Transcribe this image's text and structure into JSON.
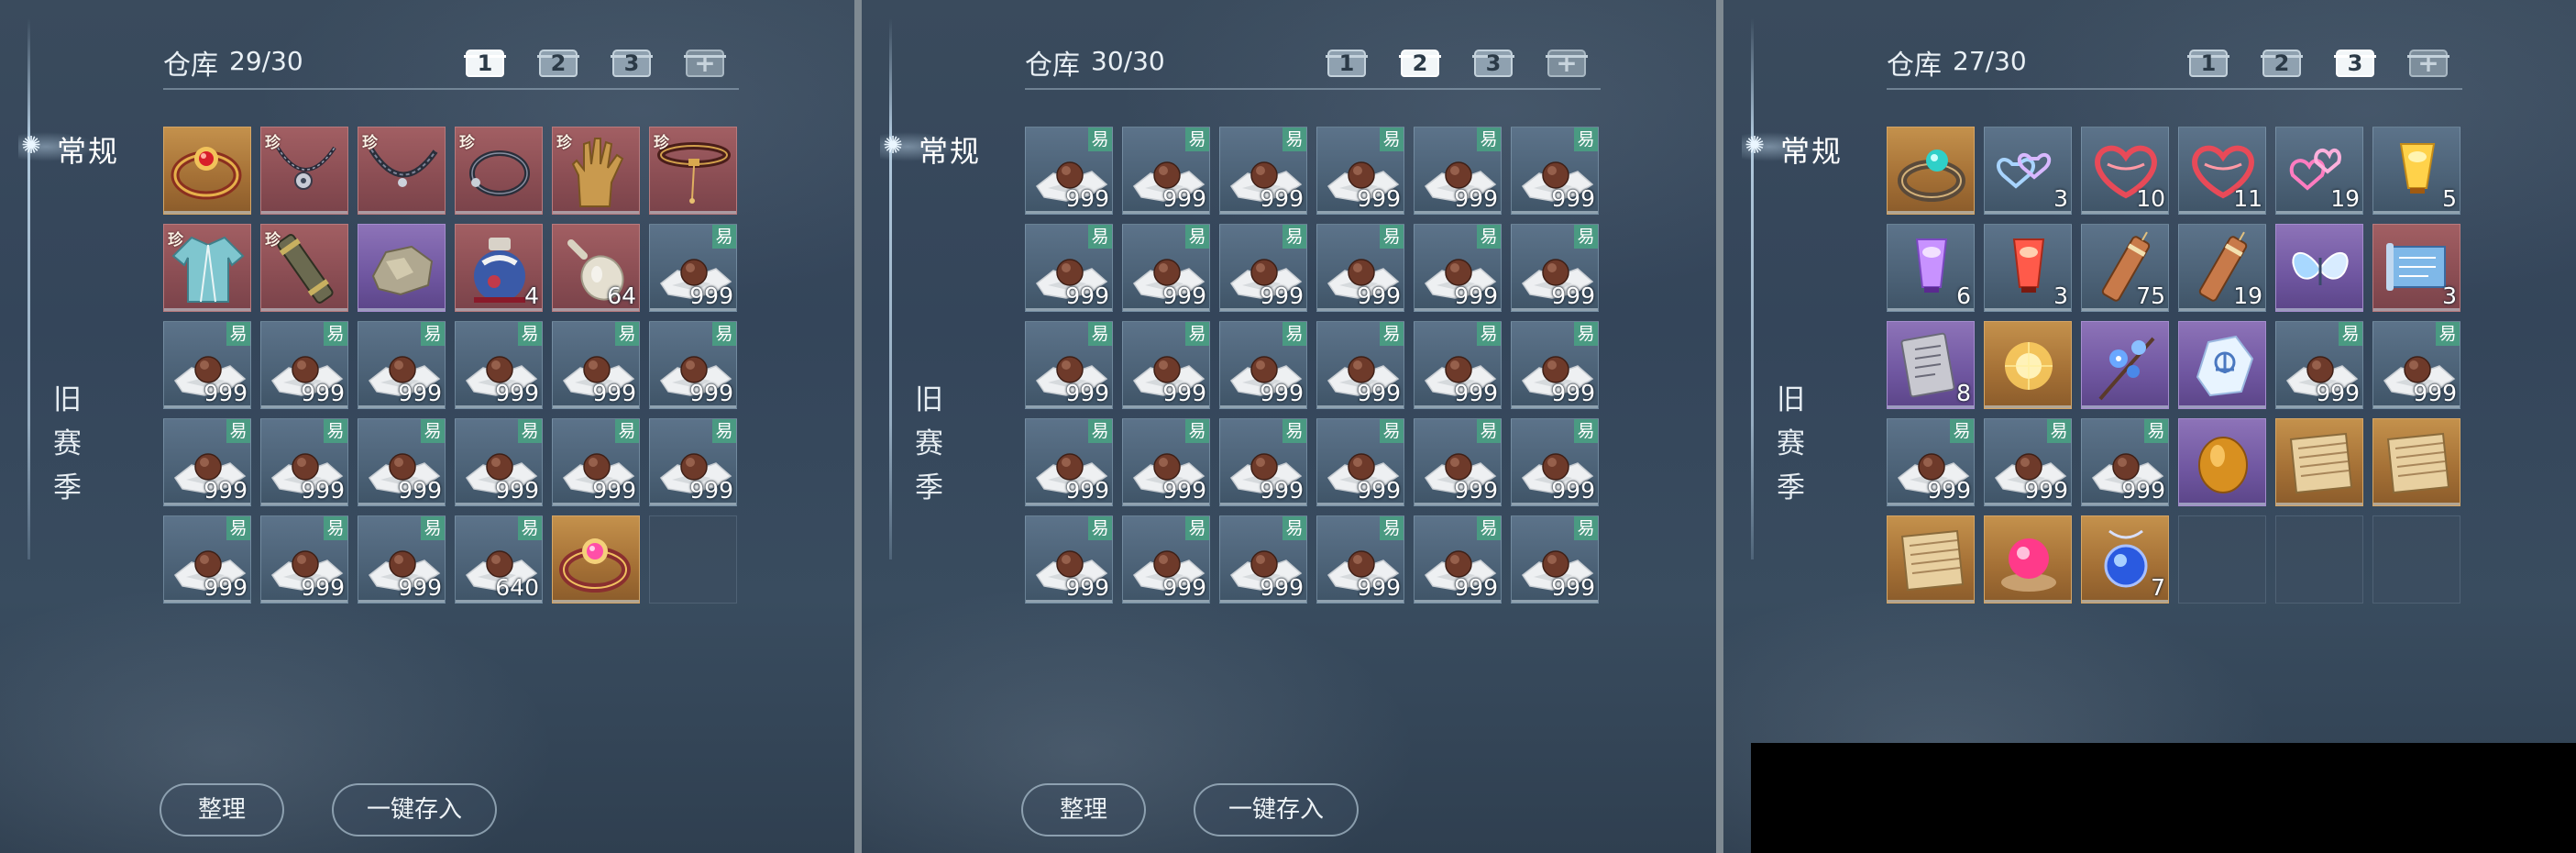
{
  "categories": {
    "regular": "常规",
    "old_season": "旧赛季"
  },
  "warehouse_title": "仓库",
  "tabs": [
    "1",
    "2",
    "3",
    "+"
  ],
  "buttons": {
    "sort": "整理",
    "deposit_all": "一键存入"
  },
  "badges": {
    "tradable": "易",
    "rare": "珍"
  },
  "panels": [
    {
      "count": "29/30",
      "active_tab": 1,
      "slots": [
        {
          "icon": "ruby-bracelet-icon",
          "bg": "gold",
          "qty": ""
        },
        {
          "icon": "pendant-necklace-icon",
          "bg": "red",
          "rare": true,
          "qty": ""
        },
        {
          "icon": "chain-necklace-icon",
          "bg": "red",
          "rare": true,
          "qty": ""
        },
        {
          "icon": "choker-necklace-icon",
          "bg": "red",
          "rare": true,
          "qty": ""
        },
        {
          "icon": "glove-icon",
          "bg": "red",
          "rare": true,
          "qty": ""
        },
        {
          "icon": "belt-icon",
          "bg": "red",
          "rare": true,
          "qty": ""
        },
        {
          "icon": "robe-icon",
          "bg": "red",
          "rare": true,
          "qty": ""
        },
        {
          "icon": "scroll-tube-icon",
          "bg": "red",
          "rare": true,
          "qty": ""
        },
        {
          "icon": "ore-chunk-icon",
          "bg": "purple",
          "qty": ""
        },
        {
          "icon": "jar-icon",
          "bg": "red",
          "qty": "4"
        },
        {
          "icon": "gourd-flask-icon",
          "bg": "red",
          "qty": "64"
        },
        {
          "icon": "chocolate-icon",
          "bg": "blue",
          "trade": true,
          "qty": "999"
        },
        {
          "icon": "chocolate-icon",
          "bg": "blue",
          "trade": true,
          "qty": "999"
        },
        {
          "icon": "chocolate-icon",
          "bg": "blue",
          "trade": true,
          "qty": "999"
        },
        {
          "icon": "chocolate-icon",
          "bg": "blue",
          "trade": true,
          "qty": "999"
        },
        {
          "icon": "chocolate-icon",
          "bg": "blue",
          "trade": true,
          "qty": "999"
        },
        {
          "icon": "chocolate-icon",
          "bg": "blue",
          "trade": true,
          "qty": "999"
        },
        {
          "icon": "chocolate-icon",
          "bg": "blue",
          "trade": true,
          "qty": "999"
        },
        {
          "icon": "chocolate-icon",
          "bg": "blue",
          "trade": true,
          "qty": "999"
        },
        {
          "icon": "chocolate-icon",
          "bg": "blue",
          "trade": true,
          "qty": "999"
        },
        {
          "icon": "chocolate-icon",
          "bg": "blue",
          "trade": true,
          "qty": "999"
        },
        {
          "icon": "chocolate-icon",
          "bg": "blue",
          "trade": true,
          "qty": "999"
        },
        {
          "icon": "chocolate-icon",
          "bg": "blue",
          "trade": true,
          "qty": "999"
        },
        {
          "icon": "chocolate-icon",
          "bg": "blue",
          "trade": true,
          "qty": "999"
        },
        {
          "icon": "chocolate-icon",
          "bg": "blue",
          "trade": true,
          "qty": "999"
        },
        {
          "icon": "chocolate-icon",
          "bg": "blue",
          "trade": true,
          "qty": "999"
        },
        {
          "icon": "chocolate-icon",
          "bg": "blue",
          "trade": true,
          "qty": "999"
        },
        {
          "icon": "chocolate-icon",
          "bg": "blue",
          "trade": true,
          "qty": "640"
        },
        {
          "icon": "pink-gem-bracelet-icon",
          "bg": "gold",
          "qty": ""
        },
        {
          "icon": "",
          "bg": "empty",
          "qty": ""
        }
      ]
    },
    {
      "count": "30/30",
      "active_tab": 2,
      "slots": [
        {
          "icon": "chocolate-icon",
          "bg": "blue",
          "trade": true,
          "qty": "999"
        },
        {
          "icon": "chocolate-icon",
          "bg": "blue",
          "trade": true,
          "qty": "999"
        },
        {
          "icon": "chocolate-icon",
          "bg": "blue",
          "trade": true,
          "qty": "999"
        },
        {
          "icon": "chocolate-icon",
          "bg": "blue",
          "trade": true,
          "qty": "999"
        },
        {
          "icon": "chocolate-icon",
          "bg": "blue",
          "trade": true,
          "qty": "999"
        },
        {
          "icon": "chocolate-icon",
          "bg": "blue",
          "trade": true,
          "qty": "999"
        },
        {
          "icon": "chocolate-icon",
          "bg": "blue",
          "trade": true,
          "qty": "999"
        },
        {
          "icon": "chocolate-icon",
          "bg": "blue",
          "trade": true,
          "qty": "999"
        },
        {
          "icon": "chocolate-icon",
          "bg": "blue",
          "trade": true,
          "qty": "999"
        },
        {
          "icon": "chocolate-icon",
          "bg": "blue",
          "trade": true,
          "qty": "999"
        },
        {
          "icon": "chocolate-icon",
          "bg": "blue",
          "trade": true,
          "qty": "999"
        },
        {
          "icon": "chocolate-icon",
          "bg": "blue",
          "trade": true,
          "qty": "999"
        },
        {
          "icon": "chocolate-icon",
          "bg": "blue",
          "trade": true,
          "qty": "999"
        },
        {
          "icon": "chocolate-icon",
          "bg": "blue",
          "trade": true,
          "qty": "999"
        },
        {
          "icon": "chocolate-icon",
          "bg": "blue",
          "trade": true,
          "qty": "999"
        },
        {
          "icon": "chocolate-icon",
          "bg": "blue",
          "trade": true,
          "qty": "999"
        },
        {
          "icon": "chocolate-icon",
          "bg": "blue",
          "trade": true,
          "qty": "999"
        },
        {
          "icon": "chocolate-icon",
          "bg": "blue",
          "trade": true,
          "qty": "999"
        },
        {
          "icon": "chocolate-icon",
          "bg": "blue",
          "trade": true,
          "qty": "999"
        },
        {
          "icon": "chocolate-icon",
          "bg": "blue",
          "trade": true,
          "qty": "999"
        },
        {
          "icon": "chocolate-icon",
          "bg": "blue",
          "trade": true,
          "qty": "999"
        },
        {
          "icon": "chocolate-icon",
          "bg": "blue",
          "trade": true,
          "qty": "999"
        },
        {
          "icon": "chocolate-icon",
          "bg": "blue",
          "trade": true,
          "qty": "999"
        },
        {
          "icon": "chocolate-icon",
          "bg": "blue",
          "trade": true,
          "qty": "999"
        },
        {
          "icon": "chocolate-icon",
          "bg": "blue",
          "trade": true,
          "qty": "999"
        },
        {
          "icon": "chocolate-icon",
          "bg": "blue",
          "trade": true,
          "qty": "999"
        },
        {
          "icon": "chocolate-icon",
          "bg": "blue",
          "trade": true,
          "qty": "999"
        },
        {
          "icon": "chocolate-icon",
          "bg": "blue",
          "trade": true,
          "qty": "999"
        },
        {
          "icon": "chocolate-icon",
          "bg": "blue",
          "trade": true,
          "qty": "999"
        },
        {
          "icon": "chocolate-icon",
          "bg": "blue",
          "trade": true,
          "qty": "999"
        }
      ]
    },
    {
      "count": "27/30",
      "active_tab": 3,
      "slots": [
        {
          "icon": "jade-ring-icon",
          "bg": "gold",
          "qty": ""
        },
        {
          "icon": "blue-hearts-icon",
          "bg": "blue",
          "qty": "3"
        },
        {
          "icon": "red-heart-ribbon-icon",
          "bg": "blue",
          "qty": "10"
        },
        {
          "icon": "red-heart-ribbon-icon",
          "bg": "blue",
          "qty": "11"
        },
        {
          "icon": "pink-hearts-icon",
          "bg": "blue",
          "qty": "19"
        },
        {
          "icon": "yellow-lantern-icon",
          "bg": "blue",
          "qty": "5"
        },
        {
          "icon": "purple-lantern-icon",
          "bg": "blue",
          "qty": "6"
        },
        {
          "icon": "red-lantern-icon",
          "bg": "blue",
          "qty": "3"
        },
        {
          "icon": "firecracker-icon",
          "bg": "blue",
          "qty": "75"
        },
        {
          "icon": "firecracker-icon",
          "bg": "blue",
          "qty": "19"
        },
        {
          "icon": "butterfly-icon",
          "bg": "purple",
          "qty": ""
        },
        {
          "icon": "blue-scroll-icon",
          "bg": "red",
          "qty": "3"
        },
        {
          "icon": "stone-tablet-icon",
          "bg": "purple",
          "qty": "8"
        },
        {
          "icon": "golden-orb-icon",
          "bg": "gold",
          "qty": ""
        },
        {
          "icon": "blue-flower-branch-icon",
          "bg": "purple",
          "qty": ""
        },
        {
          "icon": "ice-crystal-icon",
          "bg": "purple",
          "qty": ""
        },
        {
          "icon": "chocolate-icon",
          "bg": "blue",
          "trade": true,
          "qty": "999"
        },
        {
          "icon": "chocolate-icon",
          "bg": "blue",
          "trade": true,
          "qty": "999"
        },
        {
          "icon": "chocolate-icon",
          "bg": "blue",
          "trade": true,
          "qty": "999"
        },
        {
          "icon": "chocolate-icon",
          "bg": "blue",
          "trade": true,
          "qty": "999"
        },
        {
          "icon": "chocolate-icon",
          "bg": "blue",
          "trade": true,
          "qty": "999"
        },
        {
          "icon": "amber-stone-icon",
          "bg": "purple",
          "qty": ""
        },
        {
          "icon": "bamboo-mat-icon",
          "bg": "gold",
          "qty": ""
        },
        {
          "icon": "bamboo-mat-icon",
          "bg": "gold",
          "qty": ""
        },
        {
          "icon": "bamboo-mat-icon",
          "bg": "gold",
          "qty": ""
        },
        {
          "icon": "pink-orb-icon",
          "bg": "gold",
          "qty": ""
        },
        {
          "icon": "blue-orb-pendant-icon",
          "bg": "gold",
          "qty": "7"
        },
        {
          "icon": "",
          "bg": "empty",
          "qty": ""
        },
        {
          "icon": "",
          "bg": "empty",
          "qty": ""
        },
        {
          "icon": "",
          "bg": "empty",
          "qty": ""
        }
      ]
    }
  ]
}
